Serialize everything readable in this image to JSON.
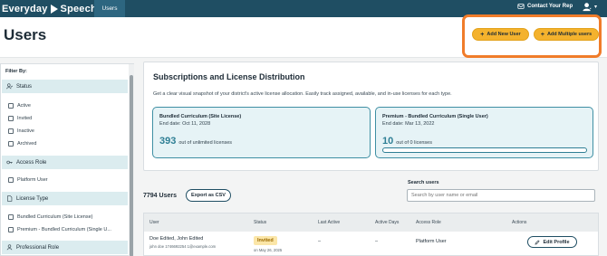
{
  "topbar": {
    "logo_left": "Everyday",
    "logo_right": "Speech",
    "nav_users": "Users",
    "contact_label": "Contact Your Rep"
  },
  "header": {
    "title": "Users",
    "add_new_user": "Add New User",
    "add_multiple_users": "Add Multiple users",
    "accent_color": "#f4b22d",
    "highlight_color": "#f07c2a"
  },
  "sidebar": {
    "filter_by": "Filter By:",
    "status": {
      "label": "Status",
      "options": [
        "Active",
        "Invited",
        "Inactive",
        "Archived"
      ]
    },
    "access_role": {
      "label": "Access Role",
      "options": [
        "Platform User"
      ]
    },
    "license_type": {
      "label": "License Type",
      "options": [
        "Bundled Curriculum (Site License)",
        "Premium - Bundled Curriculum (Single U..."
      ]
    },
    "professional_role": {
      "label": "Professional Role"
    }
  },
  "subscriptions": {
    "title": "Subscriptions and License Distribution",
    "description": "Get a clear visual snapshot of your district's active license allocation. Easily track assigned, available, and in-use licenses for each type.",
    "licenses": [
      {
        "name": "Bundled Curriculum (Site License)",
        "end_date": "End date: Oct 11, 2028",
        "count": "393",
        "suffix": "out of unlimited licenses"
      },
      {
        "name": "Premium - Bundled Curriculum (Single User)",
        "end_date": "End date: Mar 13, 2022",
        "count": "10",
        "suffix": "out of 0 licenses",
        "usage": 0.0
      }
    ]
  },
  "users": {
    "count_label": "7794 Users",
    "export_label": "Export as CSV",
    "search_label": "Search users",
    "search_placeholder": "Search by user name or email",
    "columns": [
      "User",
      "Status",
      "Last Active",
      "Active Days",
      "Access Role",
      "Actions"
    ],
    "rows": [
      {
        "name": "Doe Edited, John Edited",
        "email": "john doe 1746692254 1@example.com",
        "status": "Invited",
        "status_date": "on May 26, 2025",
        "last_active": "–",
        "active_days": "–",
        "access_role": "Platform User",
        "action": "Edit Profile"
      }
    ]
  }
}
